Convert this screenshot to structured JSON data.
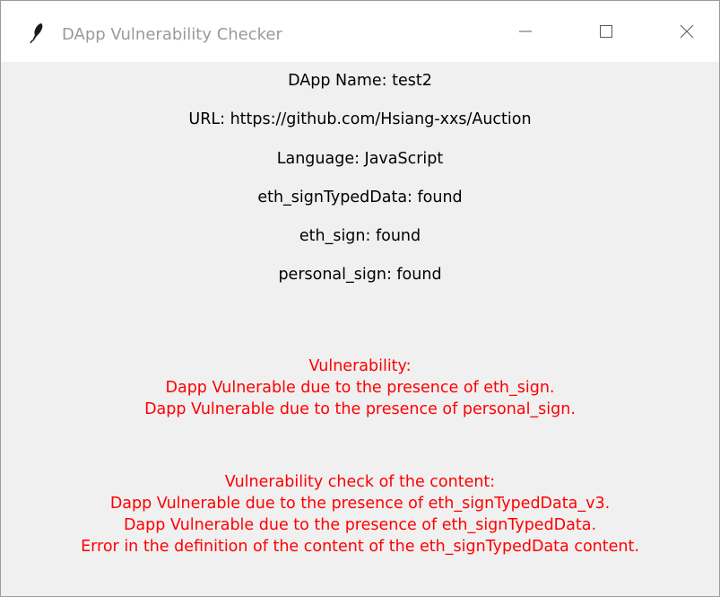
{
  "window": {
    "title": "DApp Vulnerability Checker",
    "icon": "feather-icon",
    "controls": [
      "minimize-icon",
      "maximize-icon",
      "close-icon"
    ]
  },
  "info": {
    "dapp_name": "DApp Name: test2",
    "url": "URL: https://github.com/Hsiang-xxs/Auction",
    "language": "Language: JavaScript",
    "eth_signTypedData": "eth_signTypedData: found",
    "eth_sign": "eth_sign: found",
    "personal_sign": "personal_sign: found"
  },
  "vulnerability": {
    "header": "Vulnerability:",
    "lines": [
      "Dapp Vulnerable due to the presence of eth_sign.",
      "Dapp Vulnerable due to the presence of personal_sign."
    ]
  },
  "content_check": {
    "header": "Vulnerability check of the content:",
    "lines": [
      "Dapp Vulnerable due to the presence of eth_signTypedData_v3.",
      "Dapp Vulnerable due to the presence of eth_signTypedData.",
      "Error in the definition of the content of the eth_signTypedData content."
    ]
  },
  "colors": {
    "warning_text": "#ff0000",
    "normal_text": "#000000",
    "background": "#f0f0f0",
    "titlebar": "#ffffff"
  }
}
